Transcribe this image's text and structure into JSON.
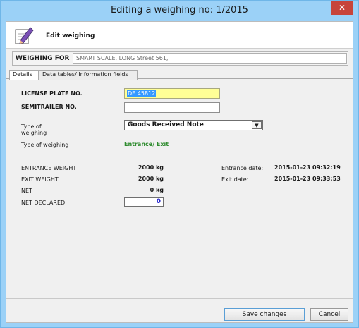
{
  "window": {
    "title": "Editing a weighing no: 1/2015",
    "close_glyph": "✕"
  },
  "header": {
    "title": "Edit weighing",
    "icon": "edit-pencil-icon"
  },
  "weighing_for": {
    "label": "WEIGHING FOR",
    "value": "SMART SCALE, LONG Street 561,"
  },
  "tabs": [
    {
      "label": "Details"
    },
    {
      "label": "Data tables/ Information fields"
    }
  ],
  "details": {
    "license_plate_label": "LICENSE PLATE NO.",
    "license_plate_value": "DE 45812",
    "semitrailer_label": "SEMITRAILER NO.",
    "semitrailer_value": "",
    "type_select_label": "Type of\nweighing",
    "type_select_value": "Goods Received Note",
    "type_label": "Type of weighing",
    "type_value": "Entrance/ Exit"
  },
  "weights": {
    "entrance_label": "ENTRANCE WEIGHT",
    "entrance_value": "2000  kg",
    "exit_label": "EXIT WEIGHT",
    "exit_value": "2000  kg",
    "net_label": "NET",
    "net_value": "0  kg",
    "net_declared_label": "NET DECLARED",
    "net_declared_value": "0"
  },
  "dates": {
    "entrance_label": "Entrance date:",
    "entrance_value": "2015-01-23 09:32:19",
    "exit_label": "Exit date:",
    "exit_value": "2015-01-23 09:33:53"
  },
  "buttons": {
    "save": "Save changes",
    "cancel": "Cancel"
  },
  "colors": {
    "titlebar": "#9bd1f7",
    "close": "#c7443a",
    "highlight_field": "#ffff96",
    "type_value": "#2e8b2e",
    "net_declared_value": "#2222cc"
  }
}
